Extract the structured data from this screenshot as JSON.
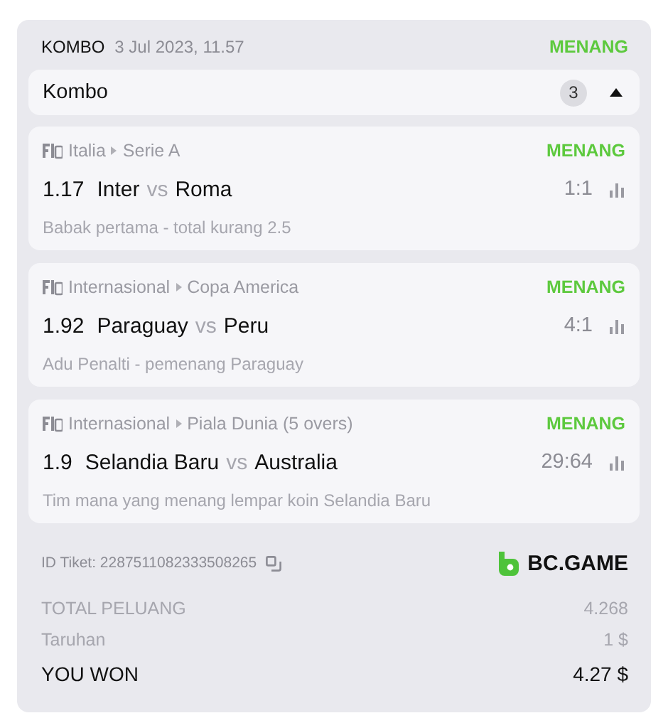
{
  "header": {
    "type": "KOMBO",
    "date": "3 Jul 2023, 11.57",
    "status": "MENANG"
  },
  "group": {
    "title": "Kombo",
    "count": "3",
    "expanded": true
  },
  "bets": [
    {
      "country": "Italia",
      "league": "Serie A",
      "status": "MENANG",
      "odds": "1.17",
      "home": "Inter",
      "vs": "vs",
      "away": "Roma",
      "score": "1:1",
      "market": "Babak pertama - total kurang 2.5"
    },
    {
      "country": "Internasional",
      "league": "Copa America",
      "status": "MENANG",
      "odds": "1.92",
      "home": "Paraguay",
      "vs": "vs",
      "away": "Peru",
      "score": "4:1",
      "market": "Adu Penalti - pemenang Paraguay"
    },
    {
      "country": "Internasional",
      "league": "Piala Dunia (5 overs)",
      "status": "MENANG",
      "odds": "1.9",
      "home": "Selandia Baru",
      "vs": "vs",
      "away": "Australia",
      "score": "29:64",
      "market": "Tim mana yang menang lempar koin Selandia Baru"
    }
  ],
  "ticket": {
    "label": "ID Tiket: 2287511082333508265",
    "brand": "BC.GAME"
  },
  "summary": [
    {
      "kind": "muted",
      "label": "TOTAL PELUANG",
      "value": "4.268"
    },
    {
      "kind": "muted",
      "label": "Taruhan",
      "value": "1 $"
    },
    {
      "kind": "strong",
      "label": "YOU WON",
      "value": "4.27 $"
    }
  ]
}
